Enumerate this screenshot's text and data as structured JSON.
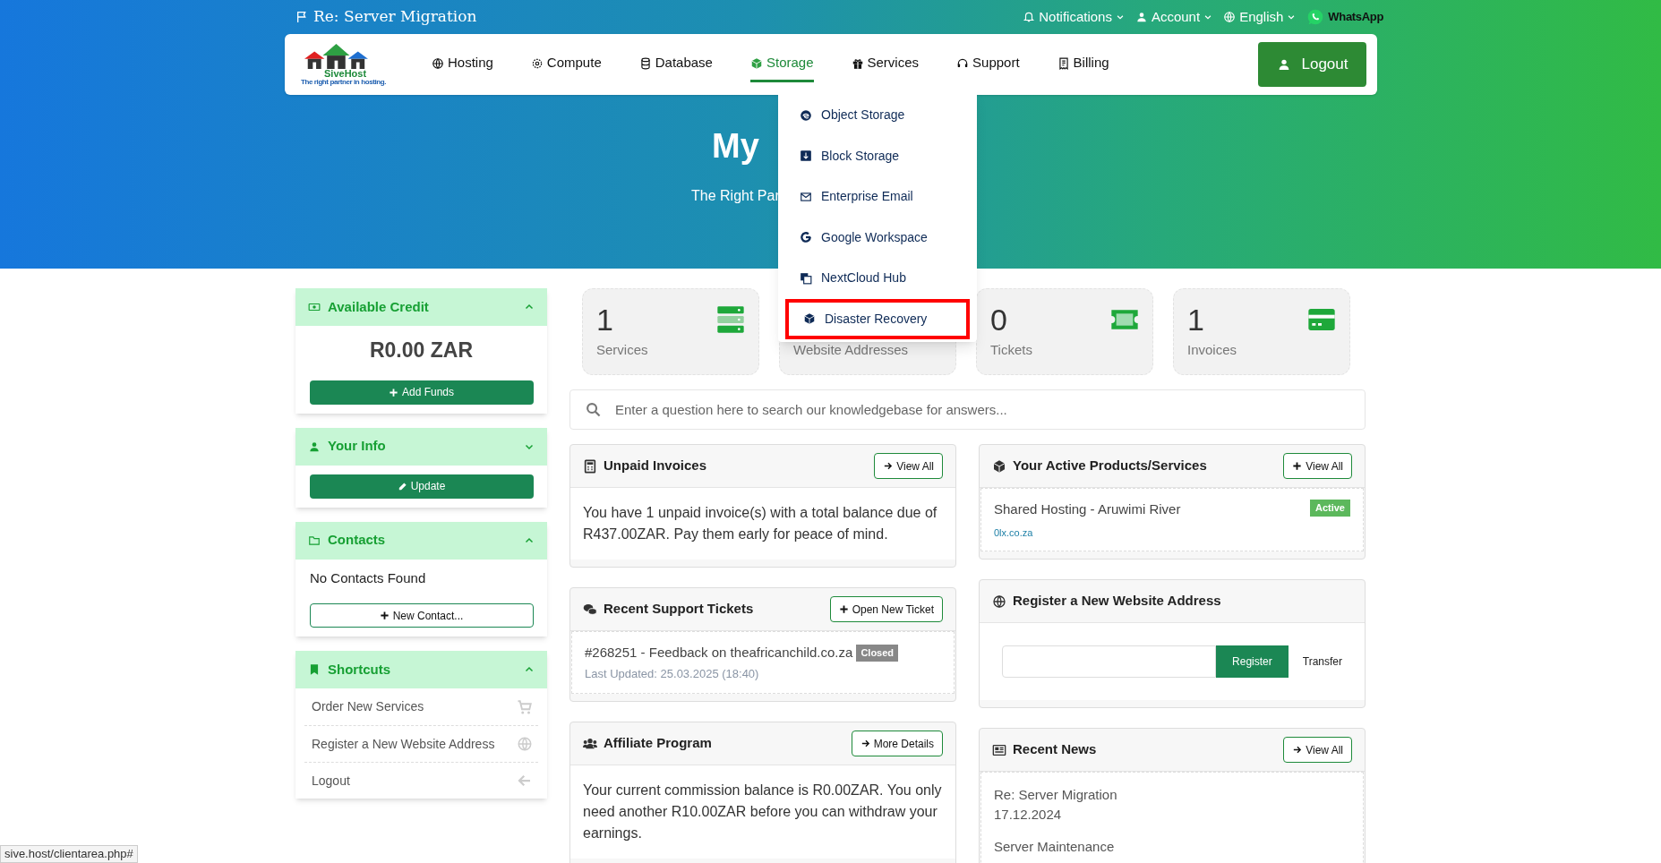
{
  "top_bar": {
    "title": "Re: Server Migration",
    "links": [
      {
        "label": "Notifications"
      },
      {
        "label": "Account"
      },
      {
        "label": "English"
      }
    ],
    "whatsapp": "WhatsApp"
  },
  "brand": {
    "name": "SiveHost",
    "tagline": "The right partner in hosting."
  },
  "nav": [
    {
      "label": "Hosting",
      "selected": false
    },
    {
      "label": "Compute",
      "selected": false
    },
    {
      "label": "Database",
      "selected": false
    },
    {
      "label": "Storage",
      "selected": true
    },
    {
      "label": "Services",
      "selected": false
    },
    {
      "label": "Support",
      "selected": false
    },
    {
      "label": "Billing",
      "selected": false
    }
  ],
  "logout": "Logout",
  "storage_menu": [
    {
      "label": "Object Storage",
      "outlined": false
    },
    {
      "label": "Block Storage",
      "outlined": false
    },
    {
      "label": "Enterprise Email",
      "outlined": false
    },
    {
      "label": "Google Workspace",
      "outlined": false
    },
    {
      "label": "NextCloud Hub",
      "outlined": false
    },
    {
      "label": "Disaster Recovery",
      "outlined": true
    }
  ],
  "hero": {
    "title": "My",
    "subtitle": "The Right Par"
  },
  "sidebar": [
    {
      "kind": "credit",
      "title": "Available Credit",
      "expanded": true,
      "amount": "R0.00 ZAR",
      "button": "Add Funds"
    },
    {
      "kind": "info",
      "title": "Your Info",
      "expanded": false,
      "button": "Update"
    },
    {
      "kind": "contacts",
      "title": "Contacts",
      "expanded": true,
      "text": "No Contacts Found",
      "button": "New Contact..."
    },
    {
      "kind": "shortcuts",
      "title": "Shortcuts",
      "expanded": true,
      "items": [
        {
          "label": "Order New Services"
        },
        {
          "label": "Register a New Website Address"
        },
        {
          "label": "Logout"
        }
      ]
    }
  ],
  "stats": [
    {
      "value": "1",
      "label": "Services"
    },
    {
      "label": "Website Addresses"
    },
    {
      "value": "0",
      "label": "Tickets"
    },
    {
      "value": "1",
      "label": "Invoices"
    }
  ],
  "search": {
    "placeholder": "Enter a question here to search our knowledgebase for answers..."
  },
  "panels_left": [
    {
      "kind": "text",
      "title": "Unpaid Invoices",
      "button": "View All",
      "text": "You have 1 unpaid invoice(s) with a total balance due of R437.00ZAR. Pay them early for peace of mind."
    },
    {
      "kind": "tickets",
      "title": "Recent Support Tickets",
      "button": "Open New Ticket",
      "tickets": [
        {
          "title": "#268251 - Feedback on theafricanchild.co.za",
          "status": "Closed",
          "updated": "Last Updated: 25.03.2025 (18:40)"
        }
      ]
    },
    {
      "kind": "text",
      "title": "Affiliate Program",
      "button": "More Details",
      "text": "Your current commission balance is R0.00ZAR. You only need another R10.00ZAR before you can withdraw your earnings."
    }
  ],
  "panels_right": [
    {
      "kind": "products",
      "title": "Your Active Products/Services",
      "button": "View All",
      "products": [
        {
          "name": "Shared Hosting - Aruwimi River",
          "status": "Active",
          "domain": "0lx.co.za"
        }
      ]
    },
    {
      "kind": "domain",
      "title": "Register a New Website Address",
      "register": "Register",
      "transfer": "Transfer"
    },
    {
      "kind": "news",
      "title": "Recent News",
      "button": "View All",
      "news": [
        {
          "title": "Re: Server Migration",
          "date": "17.12.2024"
        },
        {
          "title": "Server Maintenance"
        }
      ]
    }
  ],
  "status_url": "sive.host/clientarea.php#"
}
